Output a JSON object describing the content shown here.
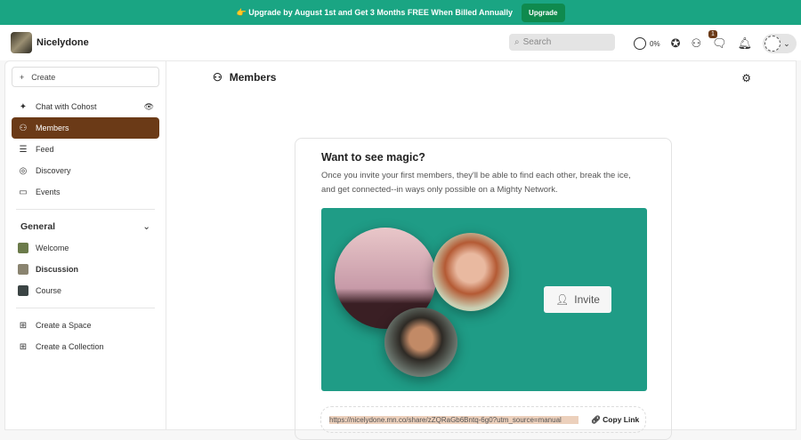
{
  "banner": {
    "text": "👉 Upgrade by August 1st and Get 3 Months FREE When Billed Annually",
    "button": "Upgrade"
  },
  "header": {
    "brand": "Nicelydone",
    "search_placeholder": "Search",
    "progress": "0%",
    "notification_count": "1"
  },
  "sidebar": {
    "create": "Create",
    "items": [
      {
        "label": "Chat with Cohost"
      },
      {
        "label": "Members"
      },
      {
        "label": "Feed"
      },
      {
        "label": "Discovery"
      },
      {
        "label": "Events"
      }
    ],
    "section": "General",
    "spaces": [
      {
        "label": "Welcome"
      },
      {
        "label": "Discussion"
      },
      {
        "label": "Course"
      }
    ],
    "actions": [
      {
        "label": "Create a Space"
      },
      {
        "label": "Create a Collection"
      }
    ]
  },
  "main": {
    "title": "Members",
    "card_title": "Want to see magic?",
    "card_text": "Once you invite your first members, they'll be able to find each other, break the ice, and get connected--in ways only possible on a Mighty Network.",
    "invite": "Invite",
    "link": "https://nicelydone.mn.co/share/zZQRaGb6Bntq-6g0?utm_source=manual",
    "copy": "Copy Link"
  },
  "colors": {
    "accent": "#1aa583",
    "brand": "#6b3a17"
  }
}
